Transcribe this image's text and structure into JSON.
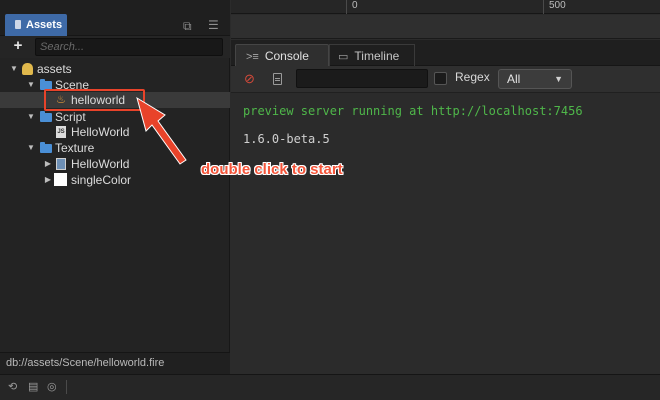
{
  "assets_panel": {
    "tab_label": "Assets",
    "search_placeholder": "Search...",
    "add_label": "+",
    "tree": {
      "root": "assets",
      "scene_folder": "Scene",
      "scene_file": "helloworld",
      "script_folder": "Script",
      "script_file": "HelloWorld",
      "texture_folder": "Texture",
      "texture_item_1": "HelloWorld",
      "texture_item_2": "singleColor"
    },
    "path": "db://assets/Scene/helloworld.fire"
  },
  "timeline_ruler": {
    "tick_0": "0",
    "tick_500": "500"
  },
  "console_panel": {
    "tabs": {
      "console": "Console",
      "timeline": "Timeline"
    },
    "filter_value": "",
    "regex_label": "Regex",
    "level_select": "All",
    "log_lines": [
      "preview server running at http://localhost:7456",
      "1.6.0-beta.5"
    ]
  },
  "annotation": {
    "text": "double click to start"
  },
  "colors": {
    "accent_tab": "#3e6aa7",
    "folder": "#4a8fd6",
    "log_green": "#4fb74a",
    "annotation_red": "#e8432a"
  },
  "icons": [
    "popout-icon",
    "menu-icon",
    "folder-icon",
    "fire-icon",
    "js-file-icon",
    "texture-icon",
    "clear-icon",
    "file-icon",
    "refresh-icon",
    "trash-icon",
    "eye-icon"
  ]
}
